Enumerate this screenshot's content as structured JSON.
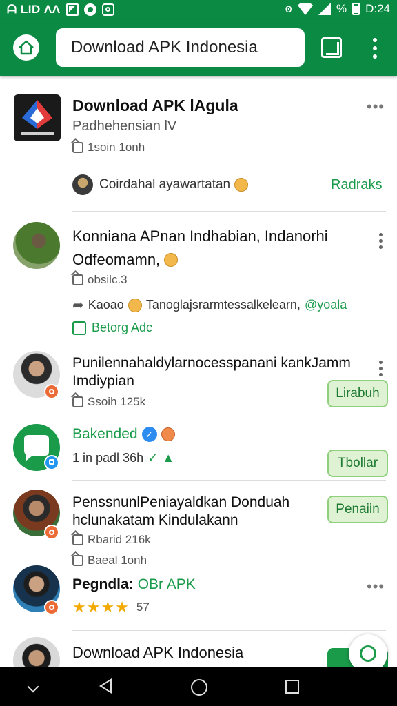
{
  "colors": {
    "brand": "#0b8a43",
    "accent_green": "#1a9b4a",
    "button_fill": "#dff3d4",
    "button_border": "#8fd07c",
    "star": "#f2a900",
    "badge_orange": "#ec6a35"
  },
  "status_bar": {
    "left_text": "ᗩ LID ΛΛ",
    "battery": "%",
    "time": "D:24"
  },
  "toolbar": {
    "search_value": "Download APK Indonesia",
    "home_icon": "home-icon",
    "tabs_icon": "tabs-icon",
    "menu_icon": "more-vert-icon"
  },
  "feed": {
    "post1": {
      "title": "Download APK lAgula",
      "subtitle": "Padhehensian lV",
      "meta": "1soin 1onh",
      "comment_text": "Coirdahal ayawartatan",
      "action": "Radraks"
    },
    "post2": {
      "title_line1": "Konniana APnan Indhabian, Indanorhi",
      "title_line2": "Odfeomamn,",
      "meta": "obsilc.3",
      "share_text": "Kaoao",
      "share_tail": "Tanoglajsrarmtessalkelearn,",
      "handle": "@yoala",
      "like_label": "Betorg Adc"
    },
    "post3": {
      "title_line1": "Punilennahaldylarnocesspanani kankJamm",
      "title_line2": "Imdiypian",
      "meta": "Ssoih 125k",
      "button": "Lirabuh"
    },
    "post4": {
      "name": "Bakended",
      "meta": "1 in padl 36h",
      "button": "Tbollar"
    },
    "post5": {
      "title_line1": "PenssnunlPeniayaldkan Donduah",
      "title_line2": "hclunakatam Kindulakann",
      "meta1": "Rbarid 216k",
      "meta2": "Baeal 1onh",
      "button": "Penaiin"
    },
    "post6": {
      "name_prefix": "Pegndla:",
      "name_suffix": "OBr APK",
      "stars": "★★★★",
      "rating_count": "57"
    },
    "post7": {
      "title": "Download APK Indonesia"
    }
  },
  "nav": {
    "down": "chevron-down-icon",
    "back": "back-icon",
    "home": "home-circle-icon",
    "recent": "recent-apps-icon"
  }
}
